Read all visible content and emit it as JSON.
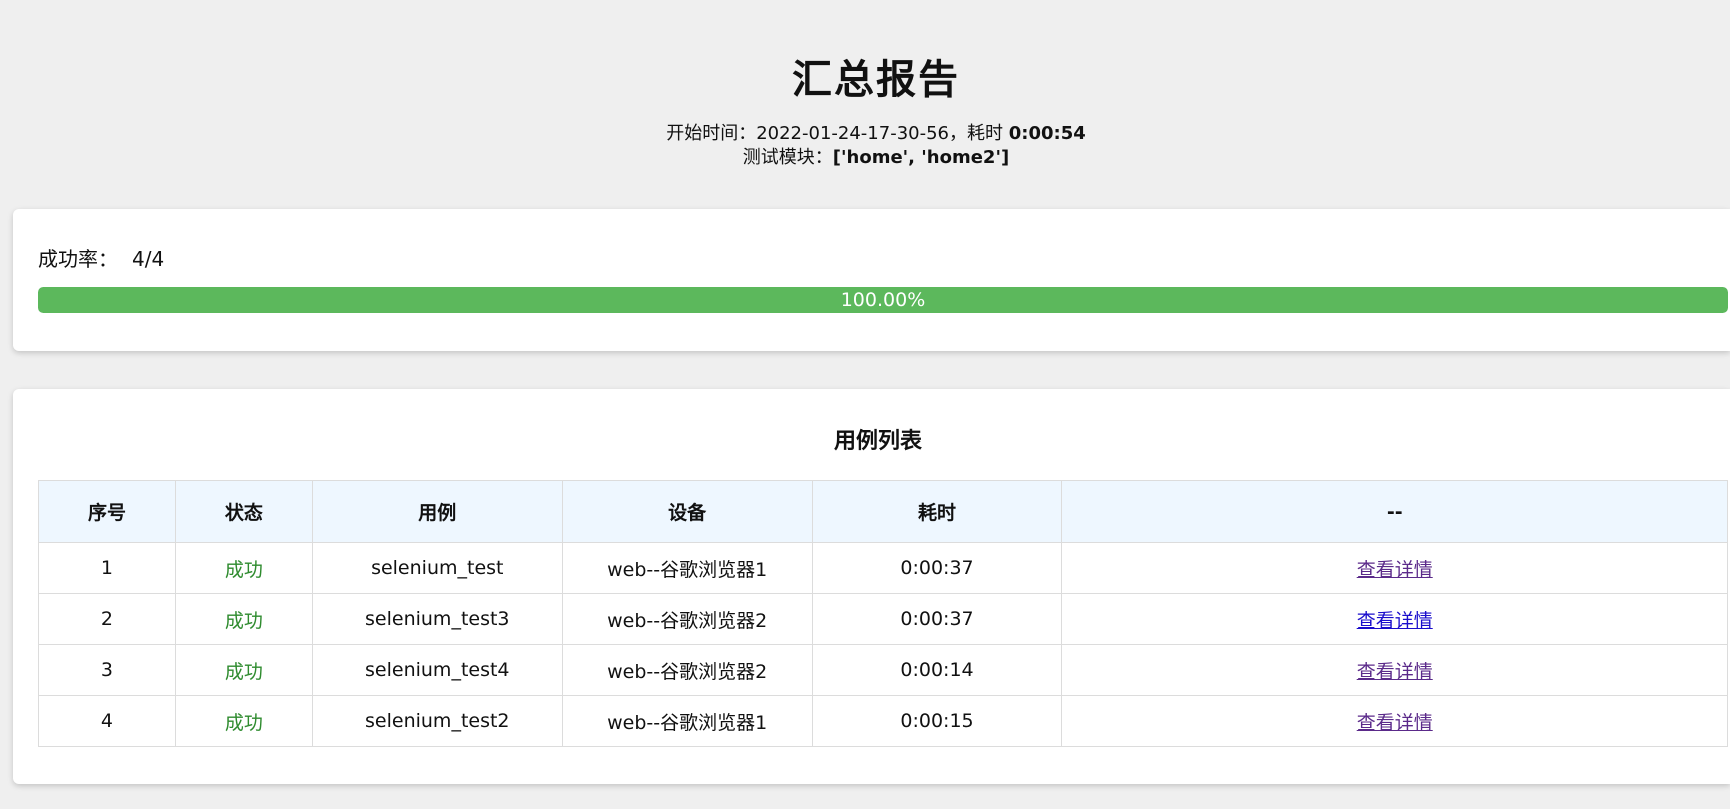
{
  "header": {
    "title": "汇总报告",
    "start_label": "开始时间：",
    "start_time": "2022-01-24-17-30-56",
    "duration_label": "，耗时 ",
    "duration": "0:00:54",
    "modules_label": "测试模块：",
    "modules": "['home', 'home2']"
  },
  "summary": {
    "rate_label": "成功率：",
    "rate_value": "4/4",
    "progress_percent": 100,
    "progress_text": "100.00%",
    "progress_color": "#5cb85c"
  },
  "case_list": {
    "title": "用例列表",
    "columns": [
      "序号",
      "状态",
      "用例",
      "设备",
      "耗时",
      "--"
    ],
    "rows": [
      {
        "index": "1",
        "status": "成功",
        "case": "selenium_test",
        "device": "web--谷歌浏览器1",
        "duration": "0:00:37",
        "action": "查看详情"
      },
      {
        "index": "2",
        "status": "成功",
        "case": "selenium_test3",
        "device": "web--谷歌浏览器2",
        "duration": "0:00:37",
        "action": "查看详情"
      },
      {
        "index": "3",
        "status": "成功",
        "case": "selenium_test4",
        "device": "web--谷歌浏览器2",
        "duration": "0:00:14",
        "action": "查看详情"
      },
      {
        "index": "4",
        "status": "成功",
        "case": "selenium_test2",
        "device": "web--谷歌浏览器1",
        "duration": "0:00:15",
        "action": "查看详情"
      }
    ]
  },
  "colors": {
    "background": "#efefef",
    "success_text": "#2e8b2e",
    "table_header_bg": "#eef7ff",
    "visited_link": "#5b2a8a",
    "link": "#1a0dcc"
  }
}
